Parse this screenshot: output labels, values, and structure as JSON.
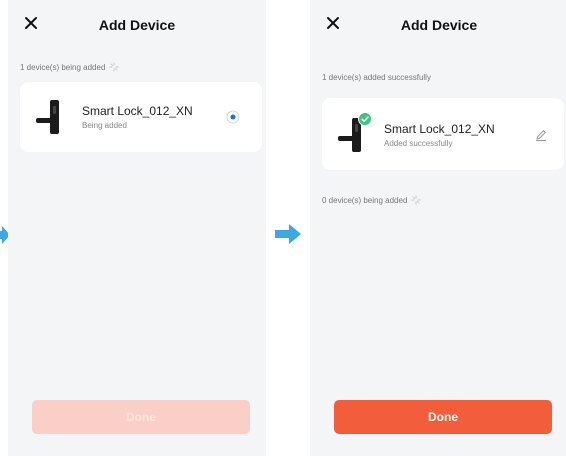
{
  "screen_adding": {
    "title": "Add Device",
    "section_label": "1 device(s) being added",
    "device": {
      "name": "Smart Lock_012_XN",
      "status": "Being added"
    },
    "done_label": "Done"
  },
  "screen_added": {
    "title": "Add Device",
    "success_label": "1 device(s) added successfully",
    "device": {
      "name": "Smart Lock_012_XN",
      "status": "Added successfully"
    },
    "pending_label": "0 device(s) being added",
    "done_label": "Done"
  },
  "icons": {
    "close": "close-icon",
    "spinner": "spinner-icon",
    "lock": "smart-lock-icon",
    "radio": "loading-radio-icon",
    "check": "check-badge-icon",
    "edit": "pencil-icon",
    "arrow": "arrow-right-icon"
  },
  "colors": {
    "accent": "#f25e3c",
    "accent_disabled": "#f9cfc7",
    "success": "#3cc480",
    "progress": "#1e6fe0",
    "arrow": "#3ea7e8",
    "screen_bg": "#f4f5f7"
  }
}
